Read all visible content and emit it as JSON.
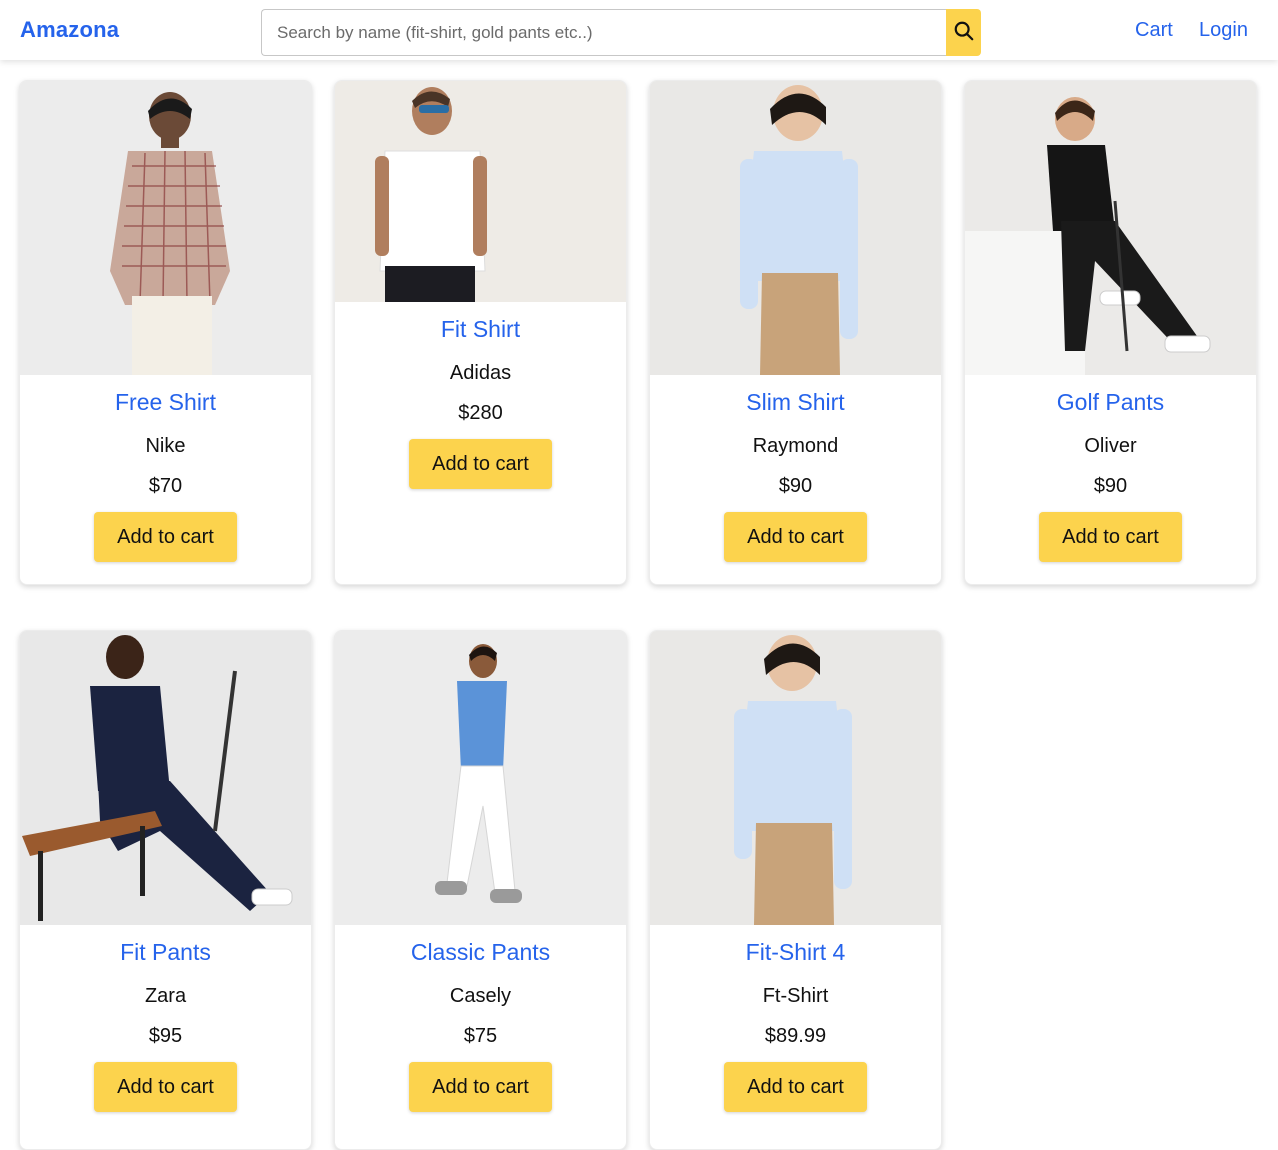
{
  "header": {
    "brand": "Amazona",
    "search_placeholder": "Search by name (fit-shirt, gold pants etc..)",
    "search_icon": "search-icon",
    "cart_label": "Cart",
    "login_label": "Login"
  },
  "colors": {
    "link": "#2563eb",
    "accent": "#fcd34d"
  },
  "products": [
    {
      "name": "Free Shirt",
      "brand": "Nike",
      "price": "$70",
      "button": "Add to cart",
      "image": "man in checked shirt and white pants"
    },
    {
      "name": "Fit Shirt",
      "brand": "Adidas",
      "price": "$280",
      "button": "Add to cart",
      "image": "man in white t-shirt with sunglasses"
    },
    {
      "name": "Slim Shirt",
      "brand": "Raymond",
      "price": "$90",
      "button": "Add to cart",
      "image": "man in light blue shirt and khaki pants"
    },
    {
      "name": "Golf Pants",
      "brand": "Oliver",
      "price": "$90",
      "button": "Add to cart",
      "image": "man in black polo holding golf club"
    },
    {
      "name": "Fit Pants",
      "brand": "Zara",
      "price": "$95",
      "button": "Add to cart",
      "image": "man in navy outfit on wooden bench"
    },
    {
      "name": "Classic Pants",
      "brand": "Casely",
      "price": "$75",
      "button": "Add to cart",
      "image": "man in blue t-shirt and white pants walking"
    },
    {
      "name": "Fit-Shirt 4",
      "brand": "Ft-Shirt",
      "price": "$89.99",
      "button": "Add to cart",
      "image": "man in light blue shirt and khaki pants"
    }
  ]
}
